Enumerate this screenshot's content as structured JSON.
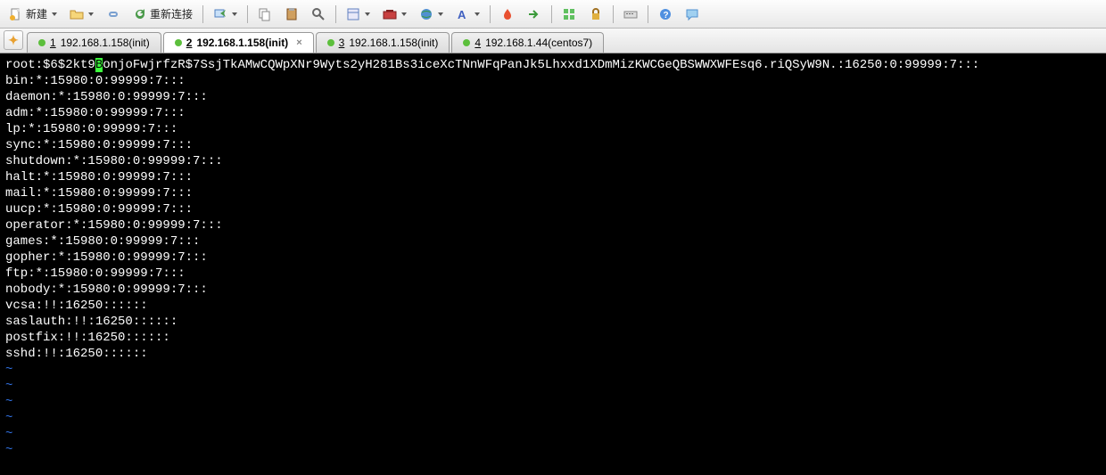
{
  "toolbar": {
    "new_label": "新建",
    "reconnect_label": "重新连接"
  },
  "tabs": [
    {
      "num": "1",
      "label": "192.168.1.158(init)",
      "active": false
    },
    {
      "num": "2",
      "label": "192.168.1.158(init)",
      "active": true
    },
    {
      "num": "3",
      "label": "192.168.1.158(init)",
      "active": false
    },
    {
      "num": "4",
      "label": "192.168.1.44(centos7)",
      "active": false
    }
  ],
  "terminal": {
    "line1_pre": "root:$6$2kt9",
    "line1_cursor": "B",
    "line1_post": "onjoFwjrfzR$7SsjTkAMwCQWpXNr9Wyts2yH281Bs3iceXcTNnWFqPanJk5Lhxxd1XDmMizKWCGeQBSWWXWFEsq6.riQSyW9N.:16250:0:99999:7:::",
    "lines": [
      "bin:*:15980:0:99999:7:::",
      "daemon:*:15980:0:99999:7:::",
      "adm:*:15980:0:99999:7:::",
      "lp:*:15980:0:99999:7:::",
      "sync:*:15980:0:99999:7:::",
      "shutdown:*:15980:0:99999:7:::",
      "halt:*:15980:0:99999:7:::",
      "mail:*:15980:0:99999:7:::",
      "uucp:*:15980:0:99999:7:::",
      "operator:*:15980:0:99999:7:::",
      "games:*:15980:0:99999:7:::",
      "gopher:*:15980:0:99999:7:::",
      "ftp:*:15980:0:99999:7:::",
      "nobody:*:15980:0:99999:7:::",
      "vcsa:!!:16250::::::",
      "saslauth:!!:16250::::::",
      "postfix:!!:16250::::::",
      "sshd:!!:16250::::::"
    ],
    "tilde": "~"
  }
}
